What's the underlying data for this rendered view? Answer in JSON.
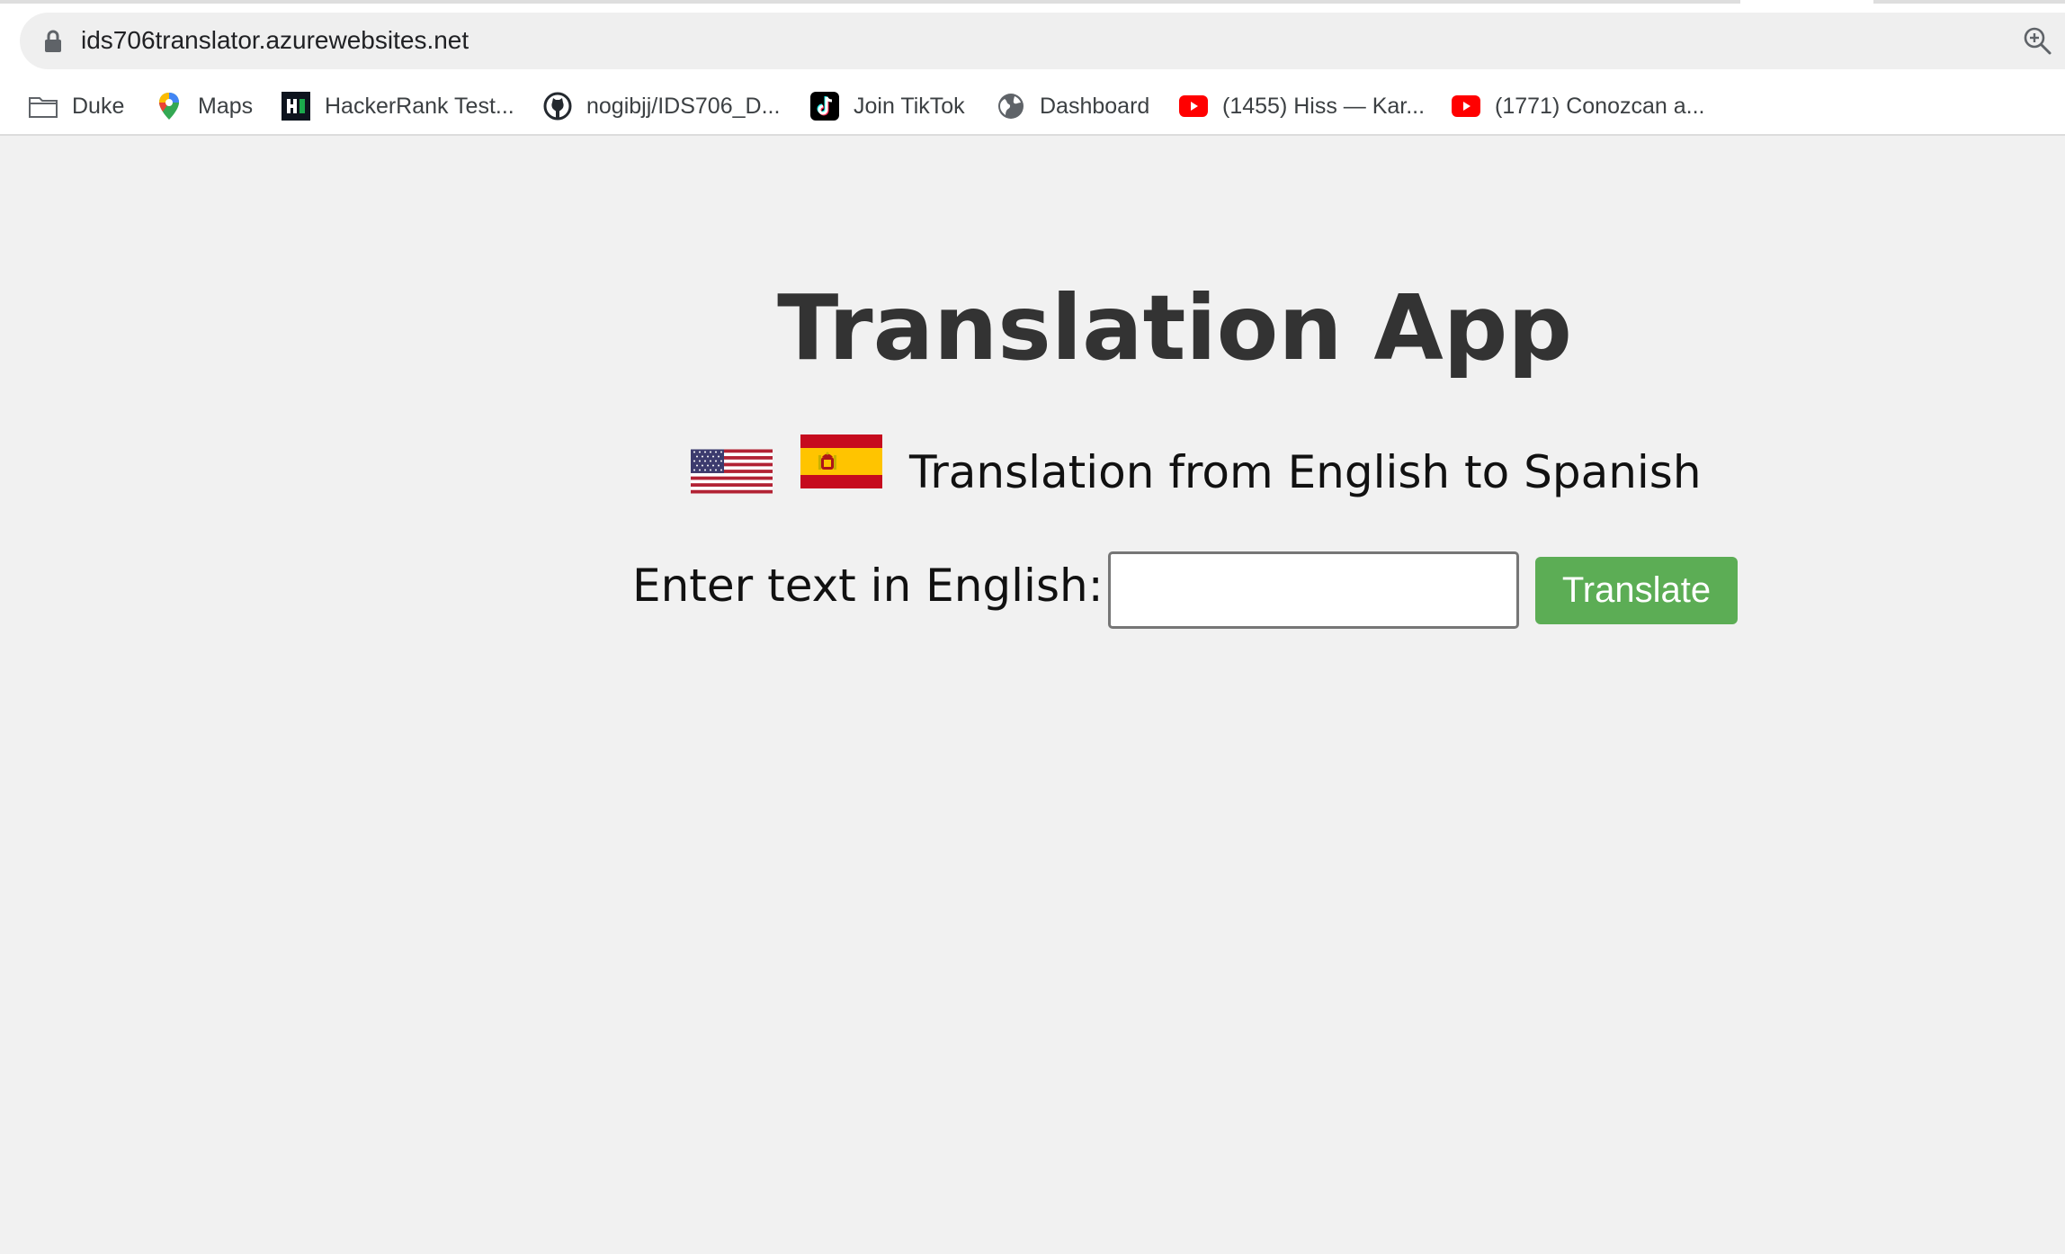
{
  "browser": {
    "url": "ids706translator.azurewebsites.net",
    "icons": {
      "lock": "lock-icon",
      "zoom": "zoom-icon"
    },
    "bookmarks": [
      {
        "label": "Duke",
        "icon": "folder-icon"
      },
      {
        "label": "Maps",
        "icon": "google-maps-icon"
      },
      {
        "label": "HackerRank Test...",
        "icon": "hackerrank-icon"
      },
      {
        "label": "nogibjj/IDS706_D...",
        "icon": "github-icon"
      },
      {
        "label": "Join TikTok",
        "icon": "tiktok-icon"
      },
      {
        "label": "Dashboard",
        "icon": "globe-icon"
      },
      {
        "label": "(1455) Hiss — Kar...",
        "icon": "youtube-icon"
      },
      {
        "label": "(1771) Conozcan a...",
        "icon": "youtube-icon"
      }
    ]
  },
  "page": {
    "title": "Translation App",
    "subtitle": "Translation from English to Spanish",
    "flags": [
      "us-flag",
      "spain-flag"
    ],
    "form": {
      "label": "Enter text in English:",
      "input_value": "",
      "input_placeholder": "",
      "button_label": "Translate"
    }
  },
  "colors": {
    "page_background": "#f1f1f1",
    "title": "#333333",
    "button": "#5cad55",
    "button_text": "#ffffff"
  }
}
